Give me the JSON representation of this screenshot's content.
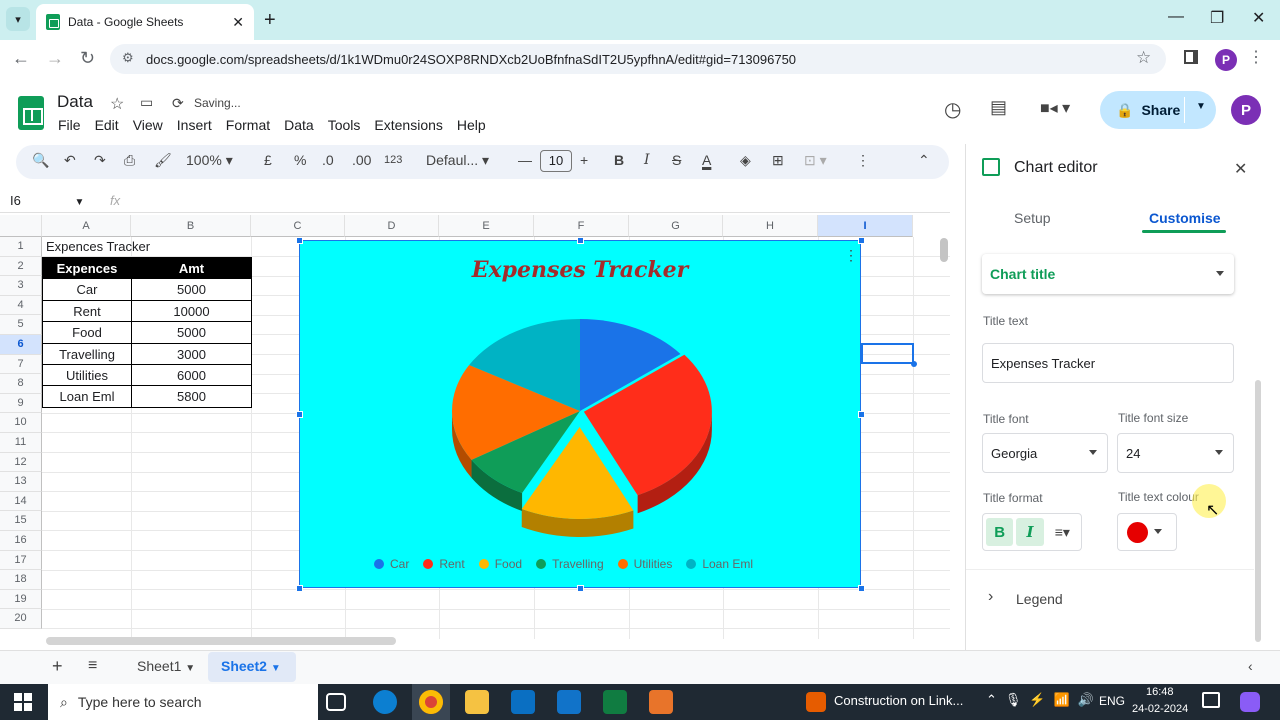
{
  "browser": {
    "tab_title": "Data - Google Sheets",
    "url": "docs.google.com/spreadsheets/d/1k1WDmu0r24SOXP8RNDXcb2UoBfnfnaSdIT2U5ypfhnA/edit#gid=713096750",
    "profile_initial": "P"
  },
  "sheets": {
    "doc_title": "Data",
    "status": "Saving...",
    "menu": [
      "File",
      "Edit",
      "View",
      "Insert",
      "Format",
      "Data",
      "Tools",
      "Extensions",
      "Help"
    ],
    "share_label": "Share",
    "profile_initial": "P"
  },
  "toolbar": {
    "zoom": "100%",
    "currency": "£",
    "percent": "%",
    "dec_decrease": ".0",
    "dec_increase": ".00",
    "number_format": "123",
    "font": "Defaul...",
    "font_size": "10"
  },
  "formula": {
    "cell_ref": "I6",
    "fx": "fx"
  },
  "grid": {
    "columns": [
      "A",
      "B",
      "C",
      "D",
      "E",
      "F",
      "G",
      "H",
      "I"
    ],
    "rows": [
      "1",
      "2",
      "3",
      "4",
      "5",
      "6",
      "7",
      "8",
      "9",
      "10",
      "11",
      "12",
      "13",
      "14",
      "15",
      "16",
      "17",
      "18",
      "19",
      "20"
    ],
    "a1": "Expences Tracker",
    "table_header": [
      "Expences",
      "Amt"
    ],
    "table_rows": [
      [
        "Car",
        "5000"
      ],
      [
        "Rent",
        "10000"
      ],
      [
        "Food",
        "5000"
      ],
      [
        "Travelling",
        "3000"
      ],
      [
        "Utilities",
        "6000"
      ],
      [
        "Loan Eml",
        "5800"
      ]
    ]
  },
  "chart_data": {
    "type": "pie",
    "title": "Expenses Tracker",
    "categories": [
      "Car",
      "Rent",
      "Food",
      "Travelling",
      "Utilities",
      "Loan Eml"
    ],
    "values": [
      5000,
      10000,
      5000,
      3000,
      6000,
      5800
    ],
    "colors": [
      "#1a73e8",
      "#ff2d1a",
      "#ffb700",
      "#0f9d58",
      "#ff6d00",
      "#00b3c4"
    ],
    "background": "#00ffff",
    "title_color": "#a52a2a",
    "legend_position": "bottom",
    "style": "3d"
  },
  "sheet_tabs": [
    "Sheet1",
    "Sheet2"
  ],
  "active_sheet": "Sheet2",
  "taskbar": {
    "search_placeholder": "Type here to search",
    "notification": "Construction on Link...",
    "lang": "ENG",
    "time": "16:48",
    "date": "24-02-2024"
  },
  "editor": {
    "title": "Chart editor",
    "tabs": [
      "Setup",
      "Customise"
    ],
    "active_tab": "Customise",
    "section": "Chart title",
    "title_text_label": "Title text",
    "title_text_value": "Expenses Tracker",
    "title_font_label": "Title font",
    "title_font_value": "Georgia",
    "title_font_size_label": "Title font size",
    "title_font_size_value": "24",
    "title_format_label": "Title format",
    "bold": "B",
    "italic": "I",
    "title_text_colour_label": "Title text colour",
    "title_colour": "#e60000",
    "legend_section": "Legend"
  }
}
